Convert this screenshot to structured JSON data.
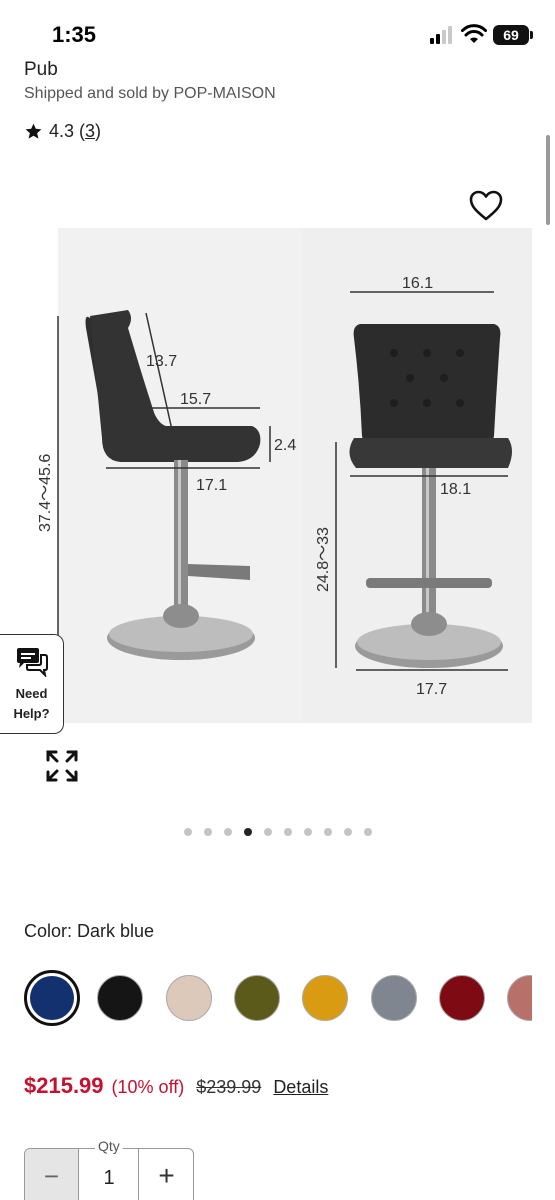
{
  "status_bar": {
    "time": "1:35",
    "battery": "69"
  },
  "product": {
    "title_fragment": "Pub",
    "shipped_by": "Shipped and sold by POP-MAISON",
    "rating": "4.3",
    "review_count": "3",
    "icons": [
      "star-icon",
      "heart-icon",
      "expand-icon",
      "chat-bubbles-icon"
    ]
  },
  "image": {
    "dimensions": {
      "back_height": "13.7",
      "seat_depth": "15.7",
      "cushion": "2.4",
      "seat_width_side": "17.1",
      "total_height": "37.4～45.6",
      "top_width": "16.1",
      "seat_width_front": "18.1",
      "seat_height": "24.8～33",
      "base": "17.7"
    },
    "carousel_count": 10,
    "carousel_active": 3
  },
  "help": {
    "line1": "Need",
    "line2": "Help?"
  },
  "color": {
    "label": "Color: Dark blue",
    "swatches": [
      {
        "name": "Dark blue",
        "hex": "#12316e",
        "selected": true
      },
      {
        "name": "Black",
        "hex": "#151515"
      },
      {
        "name": "Beige",
        "hex": "#dcc9b9"
      },
      {
        "name": "Olive",
        "hex": "#5b5a1a"
      },
      {
        "name": "Mustard",
        "hex": "#d99b12"
      },
      {
        "name": "Grey",
        "hex": "#7f8690"
      },
      {
        "name": "Burgundy",
        "hex": "#7e0a14"
      },
      {
        "name": "Rose",
        "hex": "#b8716a"
      }
    ]
  },
  "price": {
    "current": "$215.99",
    "discount": "(10% off)",
    "original": "$239.99",
    "details_label": "Details"
  },
  "quantity": {
    "label": "Qty",
    "value": "1",
    "minus": "−",
    "plus": "+"
  }
}
